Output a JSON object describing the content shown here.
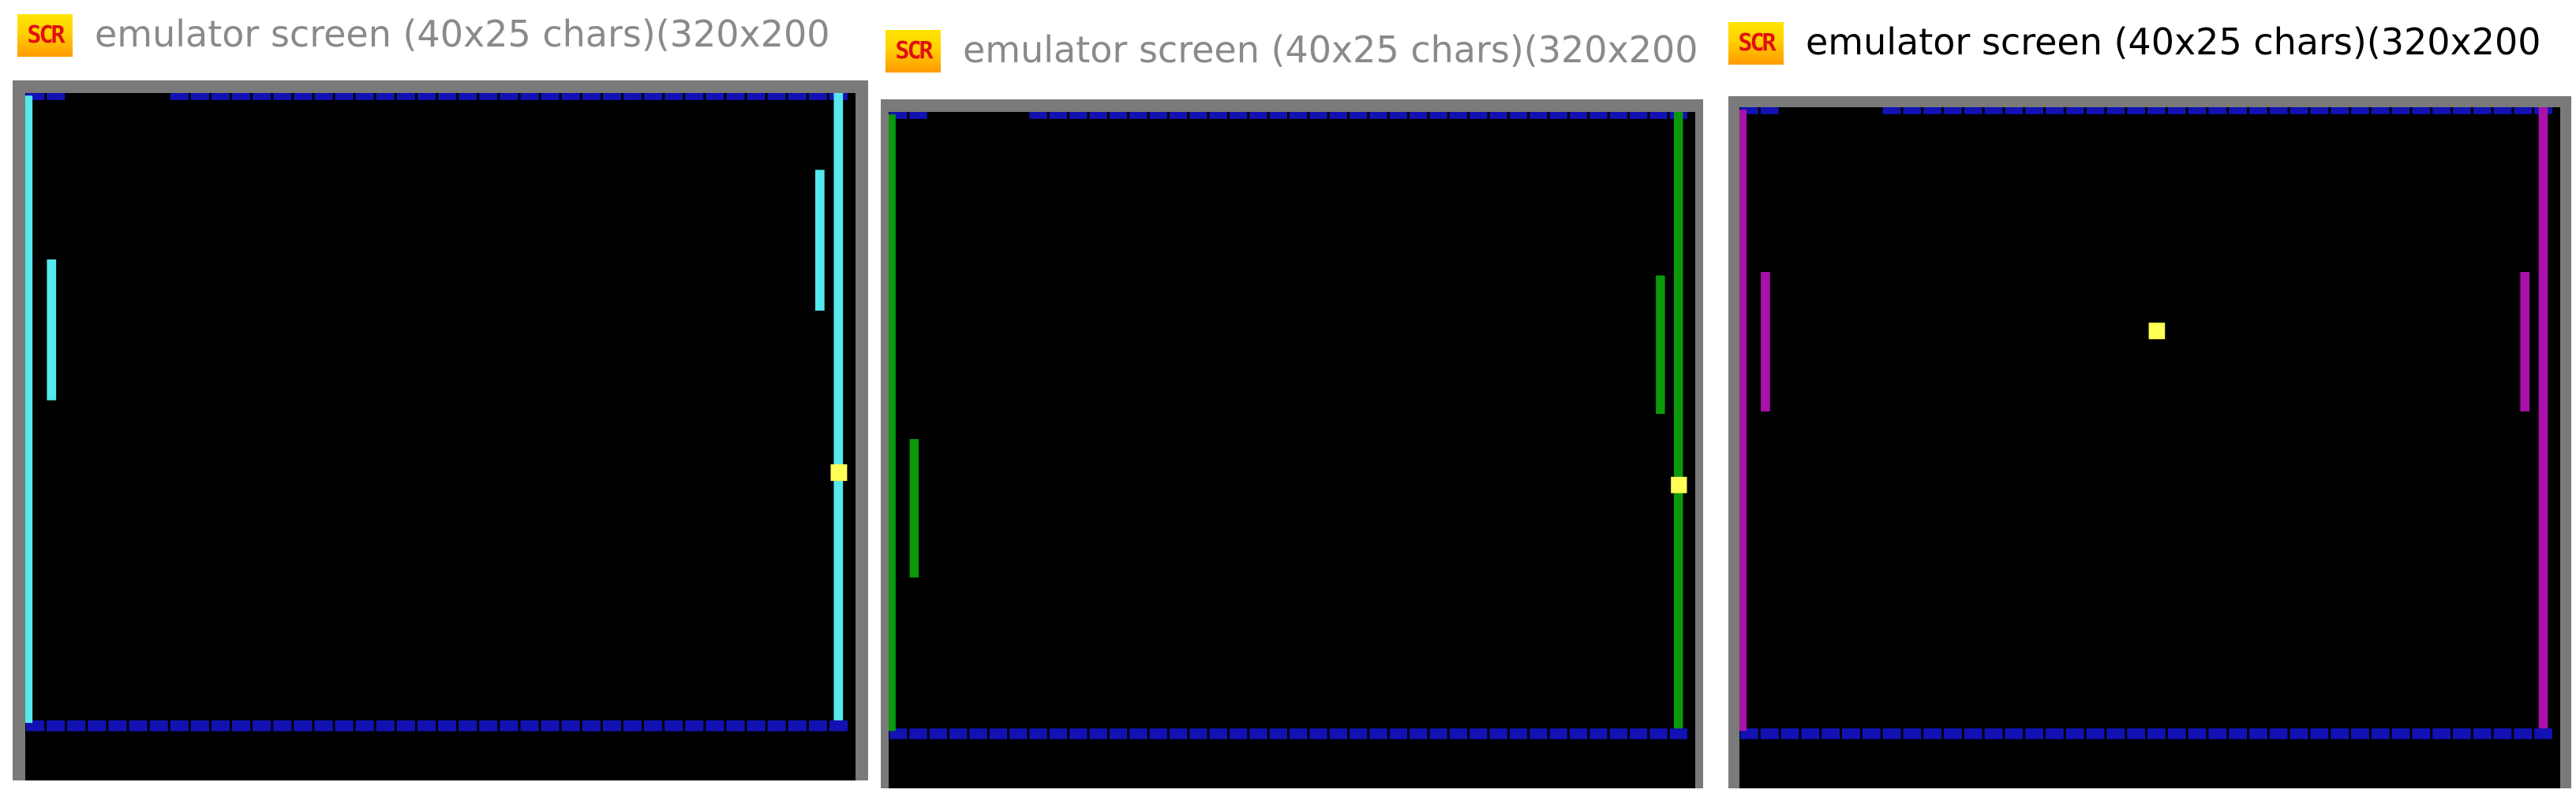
{
  "colors": {
    "frame": "#7a7a7a",
    "screen_bg": "#000000",
    "wall_blue": "#1212b4",
    "ball": "#ffff55"
  },
  "windows": [
    {
      "title": "emulator screen (40x25 chars)(320x200",
      "title_state": "inactive",
      "icon_label": "SCR",
      "icon": "scr-app-icon",
      "side_color": "#55e8ee",
      "left_paddle_rows": [
        13,
        24
      ],
      "right_paddle_rows": [
        6,
        17
      ],
      "ball_cell": [
        39,
        29
      ]
    },
    {
      "title": "emulator screen (40x25 chars)(320x200",
      "title_state": "inactive",
      "icon_label": "SCR",
      "icon": "scr-app-icon",
      "side_color": "#0a9a0a",
      "left_paddle_rows": [
        26,
        37
      ],
      "right_paddle_rows": [
        13,
        24
      ],
      "ball_cell": [
        39,
        29
      ]
    },
    {
      "title": "emulator screen (40x25 chars)(320x200",
      "title_state": "active",
      "icon_label": "SCR",
      "icon": "scr-app-icon",
      "side_color": "#aa10aa",
      "left_paddle_rows": [
        13,
        24
      ],
      "right_paddle_rows": [
        13,
        24
      ],
      "ball_cell": [
        20,
        17
      ]
    }
  ]
}
